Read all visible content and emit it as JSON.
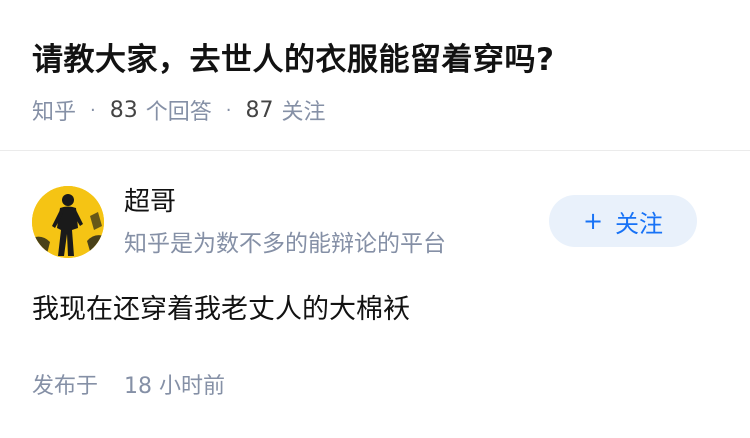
{
  "question": {
    "title": "请教大家，去世人的衣服能留着穿吗?",
    "source": "知乎",
    "answer_count": "83",
    "answer_count_label": "个回答",
    "follower_count": "87",
    "follower_label": "关注",
    "separator": "·"
  },
  "answer": {
    "author_name": "超哥",
    "author_bio": "知乎是为数不多的能辩论的平台",
    "follow_plus": "+",
    "follow_label": "关注",
    "content": "我现在还穿着我老丈人的大棉袄",
    "published_label": "发布于",
    "published_time": "18 小时前"
  },
  "colors": {
    "title": "#121212",
    "meta": "#8590a6",
    "accent": "#1772f6",
    "follow_bg": "#e9f1fb",
    "avatar_bg": "#f5c414"
  },
  "icons": {
    "avatar": "runner-silhouette-avatar"
  }
}
